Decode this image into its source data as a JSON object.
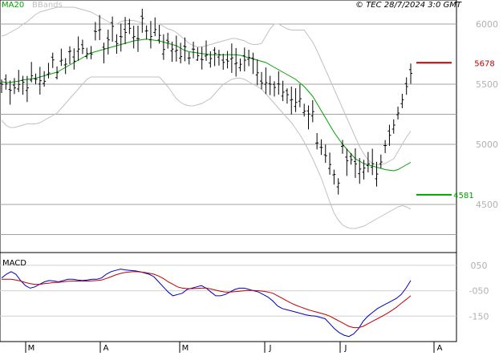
{
  "header": {
    "ma_label": "MA20",
    "bbands_label": "BBands",
    "credit": "© TEC 28/7/2024 3:0 GMT"
  },
  "macd_panel": {
    "title": "MACD"
  },
  "colors": {
    "price": "#000000",
    "ma20": "#00a000",
    "bbands": "#c0c0c0",
    "macd_line": "#0000c0",
    "signal_line": "#c00000",
    "resistance": "#c00000",
    "support": "#00a000",
    "grid": "#a0a0a0",
    "axis_text": "#b0b0b0"
  },
  "chart_data": [
    {
      "type": "ohlc",
      "title": "",
      "ylim": [
        4100,
        6200
      ],
      "y_ticks": [
        6000,
        5500,
        5000,
        4500
      ],
      "y_tick_labels": [
        "6000",
        "5500",
        "5000",
        "4500"
      ],
      "month_labels": [
        "M",
        "A",
        "M",
        "J",
        "J",
        "A"
      ],
      "series": [
        {
          "name": "MA20",
          "values": [
            5520,
            5515,
            5515,
            5520,
            5525,
            5535,
            5540,
            5545,
            5550,
            5560,
            5570,
            5580,
            5590,
            5600,
            5620,
            5640,
            5660,
            5680,
            5700,
            5720,
            5740,
            5760,
            5770,
            5780,
            5790,
            5800,
            5810,
            5820,
            5830,
            5840,
            5850,
            5860,
            5865,
            5870,
            5875,
            5870,
            5865,
            5860,
            5850,
            5840,
            5830,
            5820,
            5800,
            5780,
            5770,
            5765,
            5760,
            5755,
            5750,
            5745,
            5745,
            5745,
            5745,
            5745,
            5745,
            5745,
            5740,
            5730,
            5720,
            5710,
            5700,
            5690,
            5680,
            5660,
            5640,
            5620,
            5600,
            5580,
            5560,
            5540,
            5510,
            5480,
            5440,
            5400,
            5340,
            5280,
            5220,
            5160,
            5100,
            5050,
            5000,
            4960,
            4920,
            4880,
            4860,
            4840,
            4830,
            4820,
            4810,
            4800,
            4790,
            4785,
            4780,
            4790,
            4810,
            4830,
            4850
          ]
        },
        {
          "name": "BBands",
          "values": [
            5900,
            5910,
            5930,
            5950,
            5970,
            6000,
            6020,
            6050,
            6080,
            6100,
            6110,
            6120,
            6130,
            6140,
            6140,
            6140,
            6140,
            6140,
            6130,
            6120,
            6110,
            6100,
            6080,
            6060,
            6040,
            6020,
            6000,
            6000,
            6020,
            6030,
            6030,
            6030,
            6020,
            6010,
            6000,
            6000,
            6000,
            6000,
            5980,
            5960,
            5950,
            5930,
            5900,
            5870,
            5840,
            5820,
            5810,
            5810,
            5820,
            5830,
            5840,
            5850,
            5860,
            5870,
            5880,
            5880,
            5870,
            5860,
            5840,
            5830,
            5830,
            5840,
            5900,
            5960,
            6000,
            6000,
            5980,
            5960,
            5950,
            5950,
            5950,
            5950,
            5900,
            5850,
            5780,
            5700,
            5620,
            5540,
            5460,
            5380,
            5300,
            5220,
            5140,
            5060,
            4980,
            4920,
            4870,
            4840,
            4830,
            4830,
            4840,
            4860,
            4880,
            4940,
            5000,
            5060,
            5110
          ]
        },
        {
          "name": "BBands lower",
          "values": [
            5200,
            5160,
            5140,
            5140,
            5150,
            5160,
            5170,
            5170,
            5170,
            5180,
            5200,
            5220,
            5240,
            5260,
            5300,
            5340,
            5380,
            5420,
            5460,
            5500,
            5540,
            5560,
            5560,
            5560,
            5560,
            5560,
            5560,
            5560,
            5560,
            5560,
            5560,
            5560,
            5560,
            5560,
            5560,
            5560,
            5560,
            5560,
            5520,
            5480,
            5430,
            5380,
            5350,
            5330,
            5320,
            5320,
            5330,
            5340,
            5360,
            5380,
            5420,
            5460,
            5500,
            5520,
            5540,
            5550,
            5550,
            5540,
            5520,
            5500,
            5480,
            5460,
            5420,
            5380,
            5340,
            5300,
            5260,
            5220,
            5180,
            5130,
            5080,
            5020,
            4950,
            4880,
            4800,
            4720,
            4620,
            4520,
            4430,
            4370,
            4330,
            4310,
            4300,
            4300,
            4310,
            4320,
            4340,
            4360,
            4380,
            4400,
            4420,
            4440,
            4460,
            4480,
            4490,
            4480,
            4460
          ]
        }
      ]
    },
    {
      "type": "line",
      "title": "MACD",
      "ylim": [
        -250,
        100
      ],
      "y_ticks": [
        50,
        -50,
        -150
      ],
      "y_tick_labels": [
        "050",
        "-050",
        "-150"
      ],
      "series": [
        {
          "name": "MACD",
          "values": [
            0,
            15,
            25,
            15,
            -10,
            -30,
            -40,
            -35,
            -25,
            -15,
            -10,
            -12,
            -15,
            -10,
            -5,
            -5,
            -8,
            -10,
            -8,
            -5,
            -5,
            0,
            15,
            25,
            30,
            35,
            32,
            30,
            28,
            25,
            20,
            15,
            5,
            -15,
            -35,
            -55,
            -70,
            -65,
            -60,
            -45,
            -40,
            -35,
            -30,
            -40,
            -55,
            -70,
            -70,
            -65,
            -55,
            -45,
            -40,
            -40,
            -45,
            -50,
            -55,
            -65,
            -75,
            -90,
            -110,
            -120,
            -125,
            -130,
            -135,
            -140,
            -145,
            -148,
            -150,
            -155,
            -160,
            -180,
            -200,
            -215,
            -225,
            -230,
            -220,
            -200,
            -170,
            -150,
            -135,
            -120,
            -110,
            -100,
            -90,
            -80,
            -65,
            -40,
            -10
          ]
        },
        {
          "name": "Signal",
          "values": [
            -5,
            -5,
            -5,
            -8,
            -12,
            -18,
            -22,
            -25,
            -25,
            -22,
            -20,
            -18,
            -17,
            -15,
            -13,
            -12,
            -12,
            -12,
            -12,
            -11,
            -10,
            -8,
            -2,
            5,
            12,
            18,
            22,
            24,
            25,
            24,
            22,
            19,
            15,
            8,
            -2,
            -15,
            -25,
            -35,
            -40,
            -42,
            -42,
            -41,
            -40,
            -40,
            -43,
            -48,
            -52,
            -55,
            -55,
            -54,
            -52,
            -50,
            -49,
            -49,
            -50,
            -52,
            -55,
            -60,
            -70,
            -80,
            -90,
            -100,
            -108,
            -115,
            -122,
            -128,
            -133,
            -138,
            -143,
            -150,
            -160,
            -170,
            -180,
            -190,
            -195,
            -195,
            -190,
            -180,
            -170,
            -160,
            -150,
            -140,
            -128,
            -115,
            -100,
            -85,
            -70
          ]
        }
      ]
    }
  ],
  "levels": {
    "resistance": {
      "label": "5678",
      "value": 5678
    },
    "support": {
      "label": "4581",
      "value": 4581
    }
  }
}
